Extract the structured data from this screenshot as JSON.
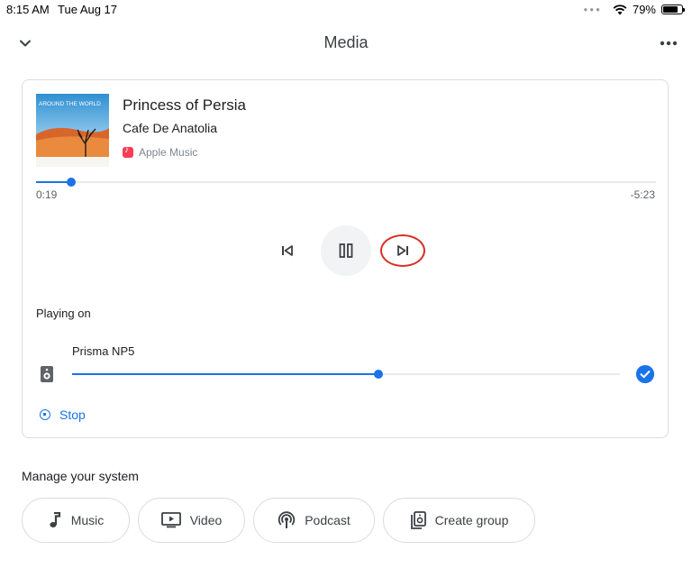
{
  "status_bar": {
    "time": "8:15 AM",
    "date": "Tue Aug 17",
    "battery": "79%",
    "battery_level": 0.79
  },
  "header": {
    "title": "Media",
    "collapse_icon": "chevron-down-icon",
    "more_icon": "more-horizontal-icon"
  },
  "now_playing": {
    "track_title": "Princess of Persia",
    "artist": "Cafe De Anatolia",
    "source": "Apple Music",
    "source_icon": "apple-music-icon",
    "album_art_text": "AROUND THE WORLD",
    "elapsed": "0:19",
    "remaining": "-5:23",
    "progress": 0.056,
    "controls": {
      "previous_icon": "skip-previous-icon",
      "pause_icon": "pause-icon",
      "next_icon": "skip-next-icon"
    }
  },
  "playing_on": {
    "label": "Playing on",
    "device_name": "Prisma NP5",
    "device_icon": "speaker-icon",
    "volume": 0.56,
    "stop_label": "Stop"
  },
  "manage": {
    "title": "Manage your system",
    "chips": [
      {
        "label": "Music",
        "icon": "music-note-icon"
      },
      {
        "label": "Video",
        "icon": "video-icon"
      },
      {
        "label": "Podcast",
        "icon": "podcast-icon"
      },
      {
        "label": "Create group",
        "icon": "create-group-icon"
      }
    ]
  },
  "colors": {
    "accent": "#1a73e8",
    "highlight_ring": "#d93025",
    "apple_music": "#fa3c54"
  }
}
